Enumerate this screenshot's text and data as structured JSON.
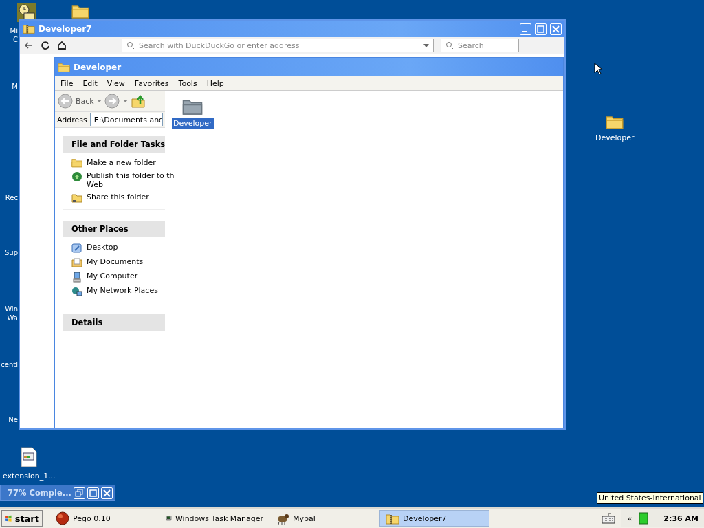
{
  "desktop_edge_labels": [
    {
      "lines": [
        "Mi",
        "C"
      ]
    },
    {
      "lines": [
        "M"
      ]
    },
    {
      "lines": [
        "Rec"
      ]
    },
    {
      "lines": [
        "Sup"
      ]
    },
    {
      "lines": [
        "Win",
        "Wa"
      ]
    },
    {
      "lines": [
        "centl"
      ]
    },
    {
      "lines": [
        "Ne"
      ]
    }
  ],
  "desktop_items": [
    {
      "label": "Developer",
      "kind": "folder"
    },
    {
      "label": "extension_1...",
      "kind": "file"
    }
  ],
  "browser_window": {
    "title": "Developer7",
    "url_placeholder": "Search with DuckDuckGo or enter address",
    "search_placeholder": "Search"
  },
  "explorer": {
    "title": "Developer",
    "menu": [
      "File",
      "Edit",
      "View",
      "Favorites",
      "Tools",
      "Help"
    ],
    "back_label": "Back",
    "address_label": "Address",
    "address": "E:\\Documents and",
    "panels": [
      {
        "title": "File and Folder Tasks",
        "items": [
          {
            "lines": [
              "Make a new folder"
            ],
            "kind": "new-folder"
          },
          {
            "lines": [
              "Publish this folder to th",
              "Web"
            ],
            "kind": "publish"
          },
          {
            "lines": [
              "Share this folder"
            ],
            "kind": "share"
          }
        ]
      },
      {
        "title": "Other Places",
        "items": [
          {
            "lines": [
              "Desktop"
            ],
            "kind": "desktop"
          },
          {
            "lines": [
              "My Documents"
            ],
            "kind": "documents"
          },
          {
            "lines": [
              "My Computer"
            ],
            "kind": "computer"
          },
          {
            "lines": [
              "My Network Places"
            ],
            "kind": "network"
          }
        ]
      },
      {
        "title": "Details"
      }
    ],
    "files": [
      {
        "name": "Developer",
        "selected": true
      }
    ]
  },
  "progress_window": {
    "title": "77% Comple..."
  },
  "tooltip": "United States-International",
  "taskbar": {
    "start": "start",
    "items": [
      {
        "label": "Pego 0.10",
        "kind": "pego",
        "selected": false
      },
      {
        "label": "Windows Task Manager",
        "kind": "monitor",
        "selected": false
      },
      {
        "label": "Mypal",
        "kind": "mypal",
        "selected": false
      },
      {
        "label": "Developer7",
        "kind": "zip-folder",
        "selected": true
      }
    ],
    "tray_expand": "«",
    "clock": "2:36 AM"
  }
}
